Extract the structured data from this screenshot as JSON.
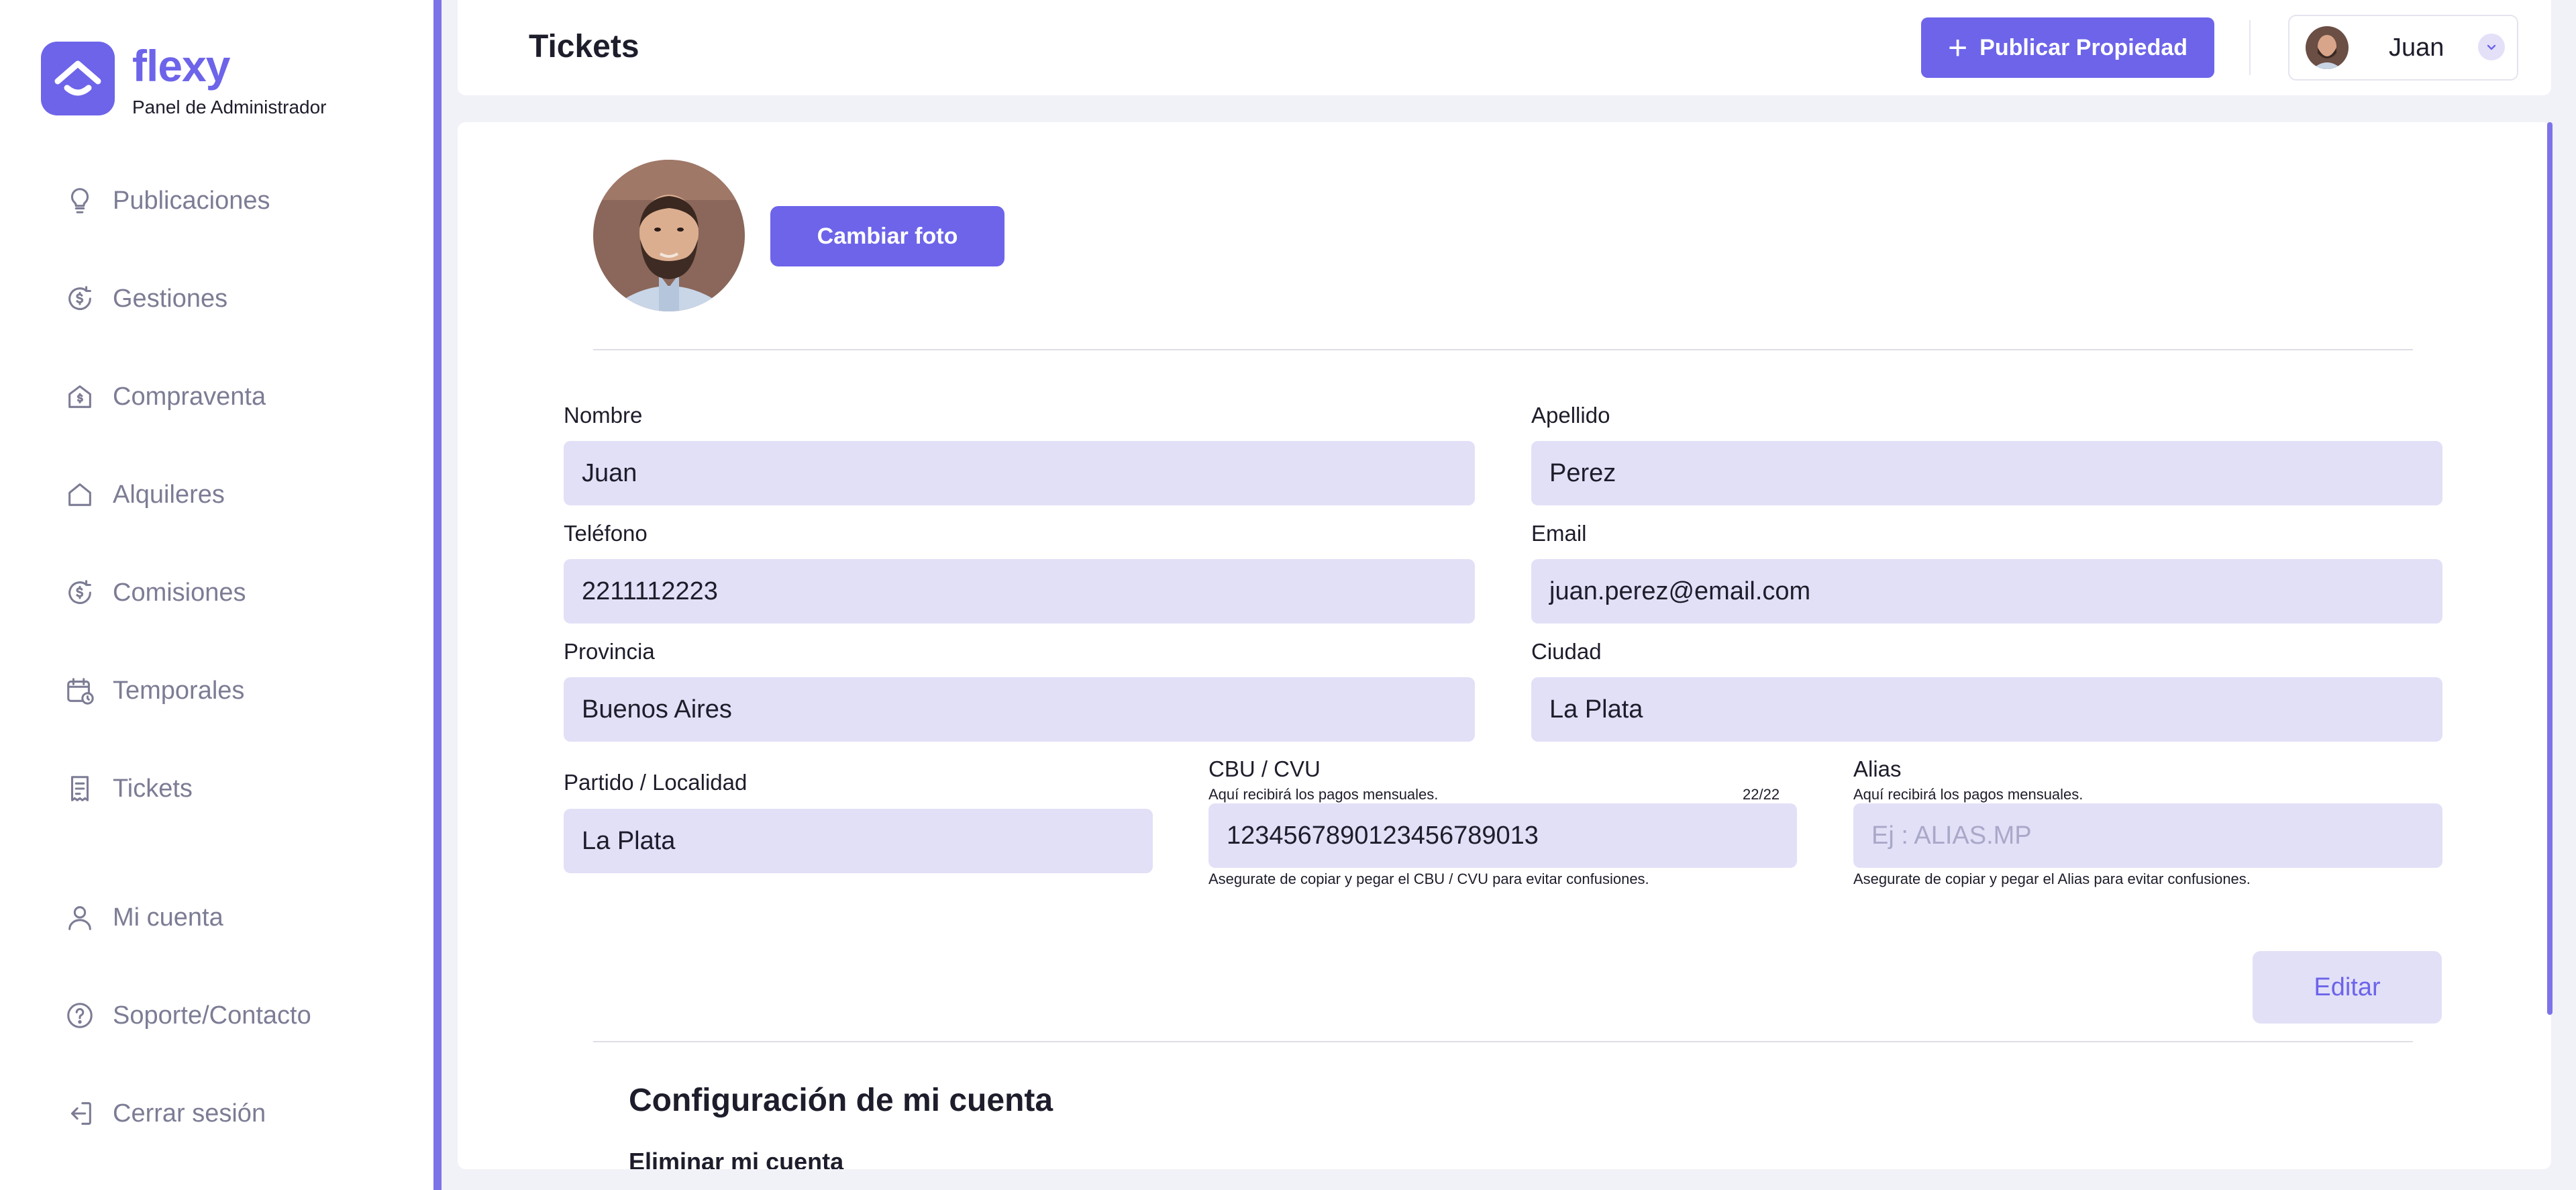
{
  "brand": {
    "name": "flexy",
    "subtitle": "Panel de Administrador"
  },
  "sidebar": {
    "items": [
      {
        "label": "Publicaciones",
        "icon": "lightbulb-icon"
      },
      {
        "label": "Gestiones",
        "icon": "coin-refresh-icon"
      },
      {
        "label": "Compraventa",
        "icon": "house-dollar-icon"
      },
      {
        "label": "Alquileres",
        "icon": "house-icon"
      },
      {
        "label": "Comisiones",
        "icon": "coin-refresh-icon"
      },
      {
        "label": "Temporales",
        "icon": "calendar-icon"
      },
      {
        "label": "Tickets",
        "icon": "receipt-icon"
      }
    ],
    "bottom_items": [
      {
        "label": "Mi cuenta",
        "icon": "user-icon"
      },
      {
        "label": "Soporte/Contacto",
        "icon": "help-circle-icon"
      },
      {
        "label": "Cerrar sesión",
        "icon": "logout-icon"
      }
    ]
  },
  "header": {
    "title": "Tickets",
    "publish_label": "Publicar Propiedad",
    "user_name": "Juan"
  },
  "profile": {
    "change_photo_label": "Cambiar foto",
    "fields": {
      "nombre": {
        "label": "Nombre",
        "value": "Juan"
      },
      "apellido": {
        "label": "Apellido",
        "value": "Perez"
      },
      "telefono": {
        "label": "Teléfono",
        "value": "2211112223"
      },
      "email": {
        "label": "Email",
        "value": "juan.perez@email.com"
      },
      "provincia": {
        "label": "Provincia",
        "value": "Buenos Aires"
      },
      "ciudad": {
        "label": "Ciudad",
        "value": "La Plata"
      },
      "partido": {
        "label": "Partido / Localidad",
        "value": "La Plata"
      },
      "cbu": {
        "label": "CBU / CVU",
        "hint": "Aquí recibirá los pagos mensuales.",
        "counter": "22/22",
        "value": "1234567890123456789013",
        "note": "Asegurate de copiar y pegar el CBU / CVU para evitar confusiones."
      },
      "alias": {
        "label": "Alias",
        "hint": "Aquí recibirá los pagos mensuales.",
        "placeholder": "Ej : ALIAS.MP",
        "note": "Asegurate de copiar y pegar el Alias para evitar confusiones."
      }
    },
    "edit_label": "Editar"
  },
  "settings": {
    "title": "Configuración de mi cuenta",
    "delete_account_title": "Eliminar mi cuenta"
  },
  "colors": {
    "accent": "#6d64ea",
    "input_bg": "#e2e0f7",
    "sidebar_bar": "#7d73e8"
  }
}
